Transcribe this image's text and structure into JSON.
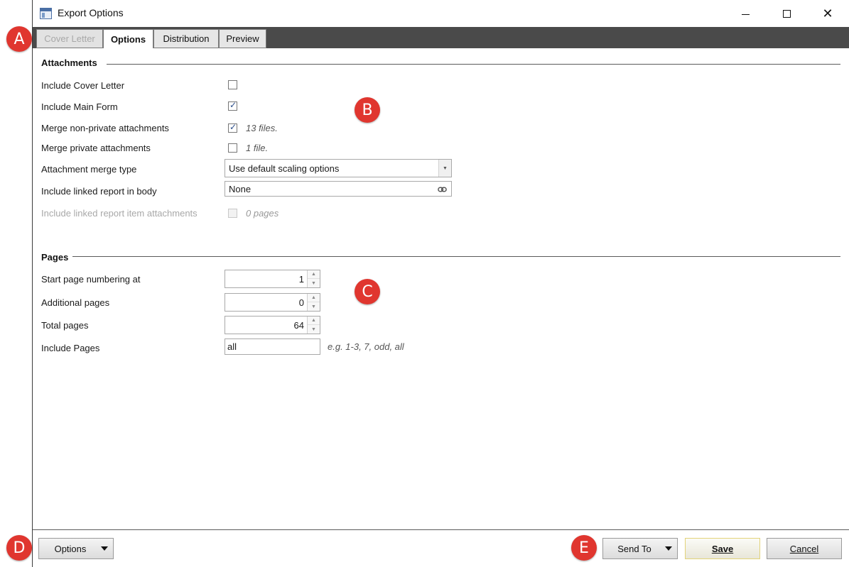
{
  "window": {
    "title": "Export Options"
  },
  "tabs": [
    {
      "label": "Cover Letter",
      "state": "disabled"
    },
    {
      "label": "Options",
      "state": "active"
    },
    {
      "label": "Distribution",
      "state": "normal"
    },
    {
      "label": "Preview",
      "state": "normal"
    }
  ],
  "attachments": {
    "section_title": "Attachments",
    "include_cover_letter": {
      "label": "Include Cover Letter",
      "checked": false
    },
    "include_main_form": {
      "label": "Include Main Form",
      "checked": true
    },
    "merge_non_private": {
      "label": "Merge non-private attachments",
      "checked": true,
      "note": "13 files."
    },
    "merge_private": {
      "label": "Merge private attachments",
      "checked": false,
      "note": "1 file."
    },
    "merge_type": {
      "label": "Attachment merge type",
      "value": "Use default scaling options"
    },
    "linked_report": {
      "label": "Include linked report in body",
      "value": "None"
    },
    "linked_report_items": {
      "label": "Include linked report item attachments",
      "checked": false,
      "note": "0 pages"
    }
  },
  "pages": {
    "section_title": "Pages",
    "start_numbering": {
      "label": "Start page numbering at",
      "value": "1"
    },
    "additional": {
      "label": "Additional pages",
      "value": "0"
    },
    "total": {
      "label": "Total pages",
      "value": "64"
    },
    "include": {
      "label": "Include Pages",
      "value": "all",
      "hint": "e.g. 1-3, 7, odd, all"
    }
  },
  "footer": {
    "options_label": "Options",
    "send_to_label": "Send To",
    "save_label": "Save",
    "cancel_label": "Cancel"
  },
  "badges": [
    "A",
    "B",
    "C",
    "D",
    "E"
  ],
  "colors": {
    "badge": "#e0362f",
    "tabbar": "#4a4a4a",
    "checkmark": "#2b4e8a"
  },
  "icons": {
    "window": "app-window-icon",
    "link": "link-icon",
    "minimize": "minimize-icon",
    "maximize": "maximize-icon",
    "close": "close-icon"
  }
}
